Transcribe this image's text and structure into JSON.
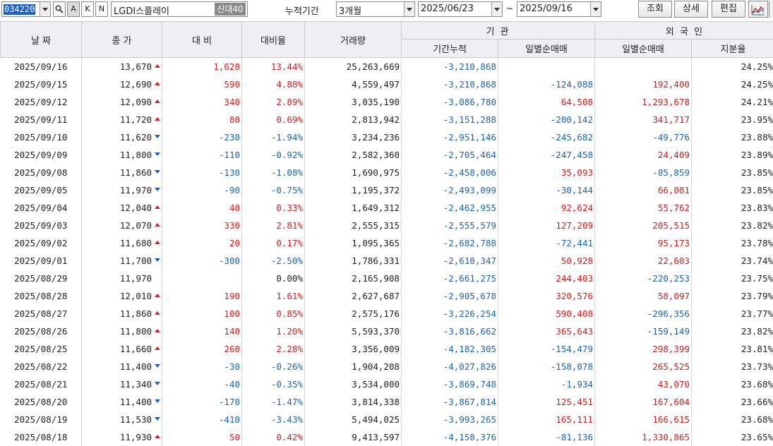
{
  "toolbar": {
    "stock_code": "034220",
    "mode_a": "A",
    "mode_k": "K",
    "mode_n": "N",
    "stock_name": "LGDi스플레이",
    "stock_name_display": "LGDI스플레이",
    "badge": "신대40",
    "period_label": "누적기간",
    "period_value": "3개월",
    "start_date": "2025/06/23",
    "tilde": "~",
    "end_date": "2025/09/16",
    "btn_query": "조회",
    "btn_detail": "상세",
    "btn_edit": "편집",
    "chart_icon": "line-chart-icon"
  },
  "headers": {
    "date": "날 짜",
    "close": "종 가",
    "change": "대 비",
    "change_rate": "대비율",
    "volume": "거래량",
    "inst_group": "기 관",
    "inst_cum": "기간누적",
    "inst_daily": "일별순매매",
    "foreign_group": "외 국 인",
    "foreign_daily": "일별순매매",
    "foreign_share": "지분율"
  },
  "colors": {
    "up": "#d21c1c",
    "down": "#1a64b4",
    "header_bg": "#eeeef3"
  },
  "rows": [
    {
      "date": "2025/09/16",
      "close": "13,670",
      "dir": "up",
      "change": "1,620",
      "rate": "13.44%",
      "volume": "25,263,669",
      "inst_cum": "-3,210,868",
      "inst_daily": "",
      "foreign_daily": "",
      "share": "24.25%"
    },
    {
      "date": "2025/09/15",
      "close": "12,690",
      "dir": "up",
      "change": "590",
      "rate": "4.88%",
      "volume": "4,559,497",
      "inst_cum": "-3,210,868",
      "inst_daily": "-124,088",
      "foreign_daily": "192,400",
      "share": "24.25%"
    },
    {
      "date": "2025/09/12",
      "close": "12,090",
      "dir": "up",
      "change": "340",
      "rate": "2.89%",
      "volume": "3,035,190",
      "inst_cum": "-3,086,780",
      "inst_daily": "64,508",
      "foreign_daily": "1,293,678",
      "share": "24.21%"
    },
    {
      "date": "2025/09/11",
      "close": "11,720",
      "dir": "up",
      "change": "80",
      "rate": "0.69%",
      "volume": "2,813,942",
      "inst_cum": "-3,151,288",
      "inst_daily": "-200,142",
      "foreign_daily": "341,717",
      "share": "23.95%"
    },
    {
      "date": "2025/09/10",
      "close": "11,620",
      "dir": "down",
      "change": "-230",
      "rate": "-1.94%",
      "volume": "3,234,236",
      "inst_cum": "-2,951,146",
      "inst_daily": "-245,682",
      "foreign_daily": "-49,776",
      "share": "23.88%"
    },
    {
      "date": "2025/09/09",
      "close": "11,800",
      "dir": "down",
      "change": "-110",
      "rate": "-0.92%",
      "volume": "2,582,360",
      "inst_cum": "-2,705,464",
      "inst_daily": "-247,458",
      "foreign_daily": "24,409",
      "share": "23.89%"
    },
    {
      "date": "2025/09/08",
      "close": "11,860",
      "dir": "down",
      "change": "-130",
      "rate": "-1.08%",
      "volume": "1,690,975",
      "inst_cum": "-2,458,006",
      "inst_daily": "35,093",
      "foreign_daily": "-85,859",
      "share": "23.85%"
    },
    {
      "date": "2025/09/05",
      "close": "11,970",
      "dir": "down",
      "change": "-90",
      "rate": "-0.75%",
      "volume": "1,195,372",
      "inst_cum": "-2,493,099",
      "inst_daily": "-30,144",
      "foreign_daily": "66,081",
      "share": "23.85%"
    },
    {
      "date": "2025/09/04",
      "close": "12,040",
      "dir": "up",
      "change": "40",
      "rate": "0.33%",
      "volume": "1,649,312",
      "inst_cum": "-2,462,955",
      "inst_daily": "92,624",
      "foreign_daily": "55,762",
      "share": "23.83%"
    },
    {
      "date": "2025/09/03",
      "close": "12,070",
      "dir": "up",
      "change": "330",
      "rate": "2.81%",
      "volume": "2,555,315",
      "inst_cum": "-2,555,579",
      "inst_daily": "127,209",
      "foreign_daily": "205,515",
      "share": "23.82%"
    },
    {
      "date": "2025/09/02",
      "close": "11,680",
      "dir": "up",
      "change": "20",
      "rate": "0.17%",
      "volume": "1,095,365",
      "inst_cum": "-2,682,788",
      "inst_daily": "-72,441",
      "foreign_daily": "95,173",
      "share": "23.78%"
    },
    {
      "date": "2025/09/01",
      "close": "11,700",
      "dir": "down",
      "change": "-300",
      "rate": "-2.50%",
      "volume": "1,786,331",
      "inst_cum": "-2,610,347",
      "inst_daily": "50,928",
      "foreign_daily": "22,603",
      "share": "23.74%"
    },
    {
      "date": "2025/08/29",
      "close": "11,970",
      "dir": "none",
      "change": "",
      "rate": "0.00%",
      "volume": "2,165,908",
      "inst_cum": "-2,661,275",
      "inst_daily": "244,403",
      "foreign_daily": "-220,253",
      "share": "23.75%"
    },
    {
      "date": "2025/08/28",
      "close": "12,010",
      "dir": "up",
      "change": "190",
      "rate": "1.61%",
      "volume": "2,627,687",
      "inst_cum": "-2,905,678",
      "inst_daily": "320,576",
      "foreign_daily": "58,097",
      "share": "23.79%"
    },
    {
      "date": "2025/08/27",
      "close": "11,860",
      "dir": "up",
      "change": "100",
      "rate": "0.85%",
      "volume": "2,575,176",
      "inst_cum": "-3,226,254",
      "inst_daily": "590,408",
      "foreign_daily": "-296,356",
      "share": "23.77%"
    },
    {
      "date": "2025/08/26",
      "close": "11,800",
      "dir": "up",
      "change": "140",
      "rate": "1.20%",
      "volume": "5,593,370",
      "inst_cum": "-3,816,662",
      "inst_daily": "365,643",
      "foreign_daily": "-159,149",
      "share": "23.82%"
    },
    {
      "date": "2025/08/25",
      "close": "11,660",
      "dir": "up",
      "change": "260",
      "rate": "2.28%",
      "volume": "3,356,009",
      "inst_cum": "-4,182,305",
      "inst_daily": "-154,479",
      "foreign_daily": "298,399",
      "share": "23.81%"
    },
    {
      "date": "2025/08/22",
      "close": "11,400",
      "dir": "down",
      "change": "-30",
      "rate": "-0.26%",
      "volume": "1,904,208",
      "inst_cum": "-4,027,826",
      "inst_daily": "-158,078",
      "foreign_daily": "265,525",
      "share": "23.73%"
    },
    {
      "date": "2025/08/21",
      "close": "11,340",
      "dir": "down",
      "change": "-40",
      "rate": "-0.35%",
      "volume": "3,534,000",
      "inst_cum": "-3,869,748",
      "inst_daily": "-1,934",
      "foreign_daily": "43,070",
      "share": "23.68%"
    },
    {
      "date": "2025/08/20",
      "close": "11,400",
      "dir": "down",
      "change": "-170",
      "rate": "-1.47%",
      "volume": "3,814,338",
      "inst_cum": "-3,867,814",
      "inst_daily": "125,451",
      "foreign_daily": "167,604",
      "share": "23.66%"
    },
    {
      "date": "2025/08/19",
      "close": "11,530",
      "dir": "down",
      "change": "-410",
      "rate": "-3.43%",
      "volume": "5,494,025",
      "inst_cum": "-3,993,265",
      "inst_daily": "165,111",
      "foreign_daily": "166,615",
      "share": "23.68%"
    },
    {
      "date": "2025/08/18",
      "close": "11,930",
      "dir": "up",
      "change": "50",
      "rate": "0.42%",
      "volume": "9,413,597",
      "inst_cum": "-4,158,376",
      "inst_daily": "-81,136",
      "foreign_daily": "1,330,865",
      "share": "23.65%"
    }
  ]
}
